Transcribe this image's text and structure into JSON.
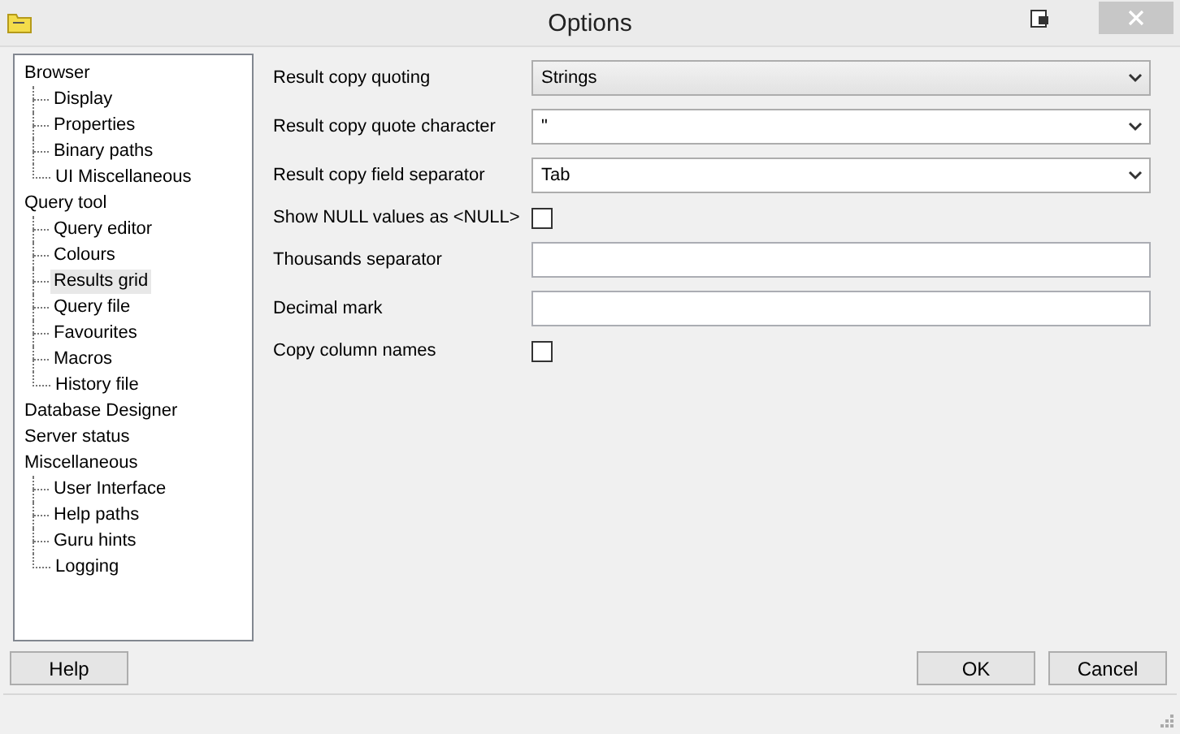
{
  "window": {
    "title": "Options"
  },
  "sidebar": {
    "items": [
      {
        "label": "Browser",
        "selected": false,
        "children": [
          {
            "label": "Display",
            "selected": false
          },
          {
            "label": "Properties",
            "selected": false
          },
          {
            "label": "Binary paths",
            "selected": false
          },
          {
            "label": "UI Miscellaneous",
            "selected": false
          }
        ]
      },
      {
        "label": "Query tool",
        "selected": false,
        "children": [
          {
            "label": "Query editor",
            "selected": false
          },
          {
            "label": "Colours",
            "selected": false
          },
          {
            "label": "Results grid",
            "selected": true
          },
          {
            "label": "Query file",
            "selected": false
          },
          {
            "label": "Favourites",
            "selected": false
          },
          {
            "label": "Macros",
            "selected": false
          },
          {
            "label": "History file",
            "selected": false
          }
        ]
      },
      {
        "label": "Database Designer",
        "selected": false
      },
      {
        "label": "Server status",
        "selected": false
      },
      {
        "label": "Miscellaneous",
        "selected": false,
        "children": [
          {
            "label": "User Interface",
            "selected": false
          },
          {
            "label": "Help paths",
            "selected": false
          },
          {
            "label": "Guru hints",
            "selected": false
          },
          {
            "label": "Logging",
            "selected": false
          }
        ]
      }
    ]
  },
  "settings": [
    {
      "kind": "dropdown",
      "label": "Result copy quoting",
      "value": "Strings"
    },
    {
      "kind": "combo",
      "label": "Result copy quote character",
      "value": "\""
    },
    {
      "kind": "combo",
      "label": "Result copy field separator",
      "value": "Tab"
    },
    {
      "kind": "checkbox",
      "label": "Show NULL values as <NULL>",
      "checked": false
    },
    {
      "kind": "text",
      "label": "Thousands separator"
    },
    {
      "kind": "text",
      "label": "Decimal mark"
    },
    {
      "kind": "checkbox",
      "label": "Copy column names",
      "checked": false
    }
  ],
  "buttons": {
    "help": "Help",
    "ok": "OK",
    "cancel": "Cancel"
  }
}
